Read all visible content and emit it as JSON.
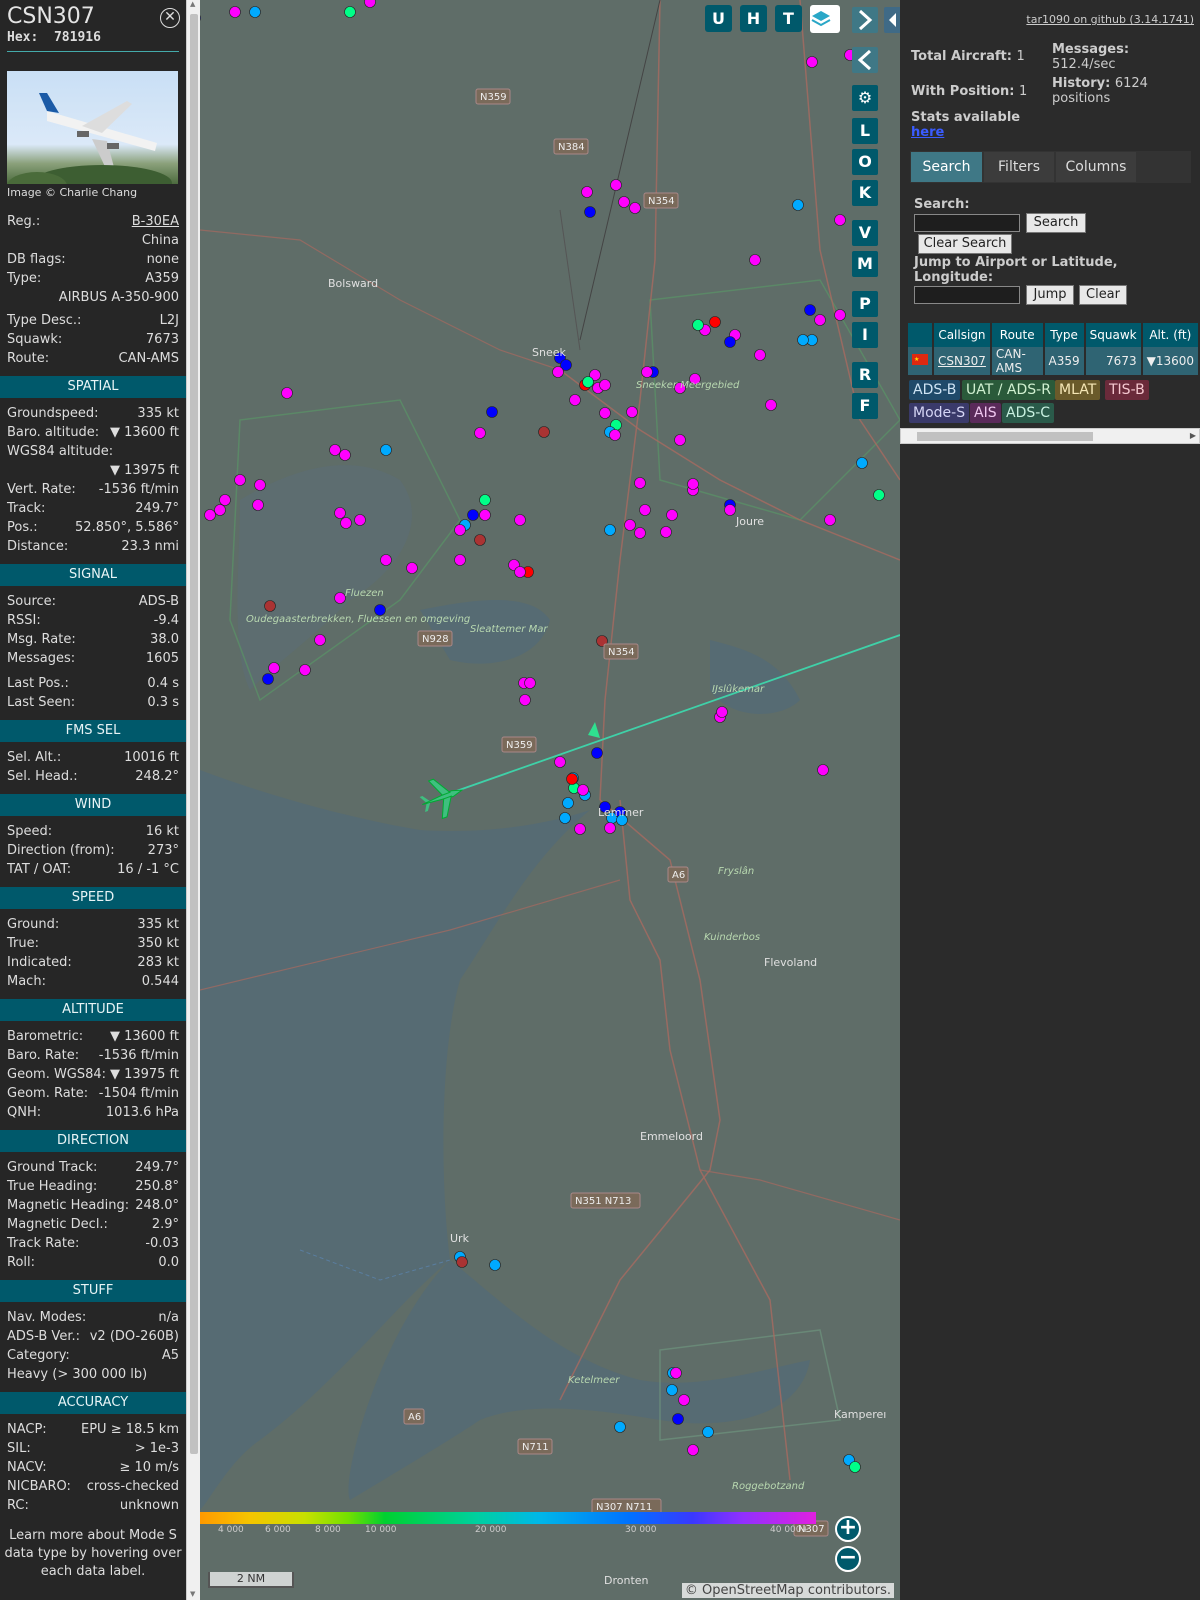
{
  "header": {
    "callsign": "CSN307",
    "hex_label": "Hex:",
    "hex": "781916",
    "close_icon": "close-icon"
  },
  "photo": {
    "credit": "Image © Charlie Chang"
  },
  "basic": [
    {
      "k": "Reg.:",
      "v": "B-30EA",
      "link": true
    },
    {
      "k": "",
      "v": "China"
    },
    {
      "k": "DB flags:",
      "v": "none"
    },
    {
      "k": "Type:",
      "v": "A359"
    },
    {
      "k": "",
      "v": "AIRBUS A-350-900"
    }
  ],
  "basic2": [
    {
      "k": "Type Desc.:",
      "v": "L2J"
    },
    {
      "k": "Squawk:",
      "v": "7673"
    },
    {
      "k": "Route:",
      "v": "CAN-AMS"
    }
  ],
  "spatial": {
    "title": "SPATIAL",
    "rows": [
      {
        "k": "Groundspeed:",
        "v": "335 kt"
      },
      {
        "k": "Baro. altitude:",
        "v": "▼ 13600 ft"
      },
      {
        "k": "WGS84 altitude:",
        "v": ""
      },
      {
        "k": "",
        "v": "▼ 13975 ft"
      },
      {
        "k": "Vert. Rate:",
        "v": "-1536 ft/min"
      },
      {
        "k": "Track:",
        "v": "249.7°"
      },
      {
        "k": "Pos.:",
        "v": "52.850°, 5.586°"
      },
      {
        "k": "Distance:",
        "v": "23.3 nmi"
      }
    ]
  },
  "signal": {
    "title": "SIGNAL",
    "rows": [
      {
        "k": "Source:",
        "v": "ADS-B"
      },
      {
        "k": "RSSI:",
        "v": "-9.4"
      },
      {
        "k": "Msg. Rate:",
        "v": "38.0"
      },
      {
        "k": "Messages:",
        "v": "1605"
      }
    ],
    "rows2": [
      {
        "k": "Last Pos.:",
        "v": "0.4 s"
      },
      {
        "k": "Last Seen:",
        "v": "0.3 s"
      }
    ]
  },
  "fms": {
    "title": "FMS SEL",
    "rows": [
      {
        "k": "Sel. Alt.:",
        "v": "10016 ft"
      },
      {
        "k": "Sel. Head.:",
        "v": "248.2°"
      }
    ]
  },
  "wind": {
    "title": "WIND",
    "rows": [
      {
        "k": "Speed:",
        "v": "16 kt"
      },
      {
        "k": "Direction (from):",
        "v": "273°"
      },
      {
        "k": "TAT / OAT:",
        "v": "16 / -1 °C"
      }
    ]
  },
  "speed": {
    "title": "SPEED",
    "rows": [
      {
        "k": "Ground:",
        "v": "335 kt"
      },
      {
        "k": "True:",
        "v": "350 kt"
      },
      {
        "k": "Indicated:",
        "v": "283 kt"
      },
      {
        "k": "Mach:",
        "v": "0.544"
      }
    ]
  },
  "altitude": {
    "title": "ALTITUDE",
    "rows": [
      {
        "k": "Barometric:",
        "v": "▼ 13600 ft"
      },
      {
        "k": "Baro. Rate:",
        "v": "-1536 ft/min"
      },
      {
        "k": "Geom. WGS84:",
        "v": "▼ 13975 ft"
      },
      {
        "k": "Geom. Rate:",
        "v": "-1504 ft/min"
      },
      {
        "k": "QNH:",
        "v": "1013.6 hPa"
      }
    ]
  },
  "direction": {
    "title": "DIRECTION",
    "rows": [
      {
        "k": "Ground Track:",
        "v": "249.7°"
      },
      {
        "k": "True Heading:",
        "v": "250.8°"
      },
      {
        "k": "Magnetic Heading:",
        "v": "248.0°"
      },
      {
        "k": "Magnetic Decl.:",
        "v": "2.9°"
      },
      {
        "k": "Track Rate:",
        "v": "-0.03"
      },
      {
        "k": "Roll:",
        "v": "0.0"
      }
    ]
  },
  "stuff": {
    "title": "STUFF",
    "rows": [
      {
        "k": "Nav. Modes:",
        "v": "n/a"
      },
      {
        "k": "ADS-B Ver.:",
        "v": "v2 (DO-260B)"
      },
      {
        "k": "Category:",
        "v": "A5"
      },
      {
        "k": "Heavy (> 300 000 lb)",
        "v": ""
      }
    ]
  },
  "accuracy": {
    "title": "ACCURACY",
    "rows": [
      {
        "k": "NACP:",
        "v": "EPU ≥ 18.5 km"
      },
      {
        "k": "SIL:",
        "v": "> 1e-3"
      },
      {
        "k": "NACV:",
        "v": "≥ 10 m/s"
      },
      {
        "k": "NICBARO:",
        "v": "cross-checked"
      },
      {
        "k": "RC:",
        "v": "unknown"
      }
    ]
  },
  "learn_more": "Learn more about Mode S data type by hovering over each data label.",
  "map": {
    "top_buttons": [
      "U",
      "H",
      "T"
    ],
    "side_buttons": [
      "L",
      "O",
      "K",
      "V",
      "M",
      "P",
      "I",
      "R",
      "F"
    ],
    "layers_icon": "layers-icon",
    "settings_icon": "gear-icon",
    "expand_icon": "chevron-right-icon",
    "collapse_icon": "chevron-left-icon",
    "toggle_icon": "arrows-left-right-icon",
    "places": [
      "Bolsward",
      "Sneek",
      "Sneeker Meergebied",
      "Joure",
      "Oudegaasterbrekken, Fluessen en omgeving",
      "Fluezen",
      "Sleattemer Mar",
      "IJslûkemar",
      "Lemmer",
      "Kuinderbos",
      "Flevoland",
      "Emmeloord",
      "Urk",
      "Ketelmeer",
      "Roggebotzand",
      "Dronten",
      "Kampereı",
      "Fryslân"
    ],
    "roads": [
      "N359",
      "N384",
      "N354",
      "N928",
      "N354",
      "N359",
      "A6",
      "N351 N713",
      "N711",
      "N307 N711",
      "N307",
      "A6"
    ],
    "zoom_in_icon": "plus-icon",
    "zoom_out_icon": "minus-icon",
    "scale": "2 NM",
    "colorbar_ticks": [
      "4 000",
      "6 000",
      "8 000",
      "10 000",
      "20 000",
      "30 000",
      "40 000+"
    ],
    "attribution": "© OpenStreetMap contributors."
  },
  "right": {
    "github": "tar1090 on github (3.14.1741)",
    "total_label": "Total Aircraft:",
    "total": "1",
    "withpos_label": "With Position:",
    "withpos": "1",
    "stats_label": "Stats available",
    "stats_link": "here",
    "msgs_label": "Messages:",
    "msgs": "512.4/sec",
    "hist_label": "History:",
    "hist": "6124 positions",
    "tabs": [
      "Search",
      "Filters",
      "Columns"
    ],
    "search_label": "Search:",
    "search_btn": "Search",
    "clear_search_btn": "Clear Search",
    "jump_label": "Jump to Airport or Latitude, Longitude:",
    "jump_btn": "Jump",
    "clear_btn": "Clear",
    "table": {
      "headers": [
        "",
        "Callsign",
        "Route",
        "Type",
        "Squawk",
        "Alt. (ft)"
      ],
      "rows": [
        [
          "",
          "CSN307",
          "CAN-AMS",
          "A359",
          "7673",
          "▼13600"
        ]
      ]
    },
    "sources": [
      {
        "label": "ADS-B",
        "bg": "#1f4a6a",
        "fg": "#cfe4f5"
      },
      {
        "label": "UAT / ADS-R",
        "bg": "#2a5a3a",
        "fg": "#d0f0d0"
      },
      {
        "label": "MLAT",
        "bg": "#6a5a2a",
        "fg": "#f5e6b5"
      },
      {
        "label": "TIS-B",
        "bg": "#6a2a3a",
        "fg": "#f5c8d0"
      },
      {
        "label": "Mode-S",
        "bg": "#3a3a6a",
        "fg": "#d5d5f5"
      },
      {
        "label": "AIS",
        "bg": "#5a2a5a",
        "fg": "#f0c8f0"
      },
      {
        "label": "ADS-C",
        "bg": "#2a5a4a",
        "fg": "#c8f0e0"
      }
    ]
  }
}
